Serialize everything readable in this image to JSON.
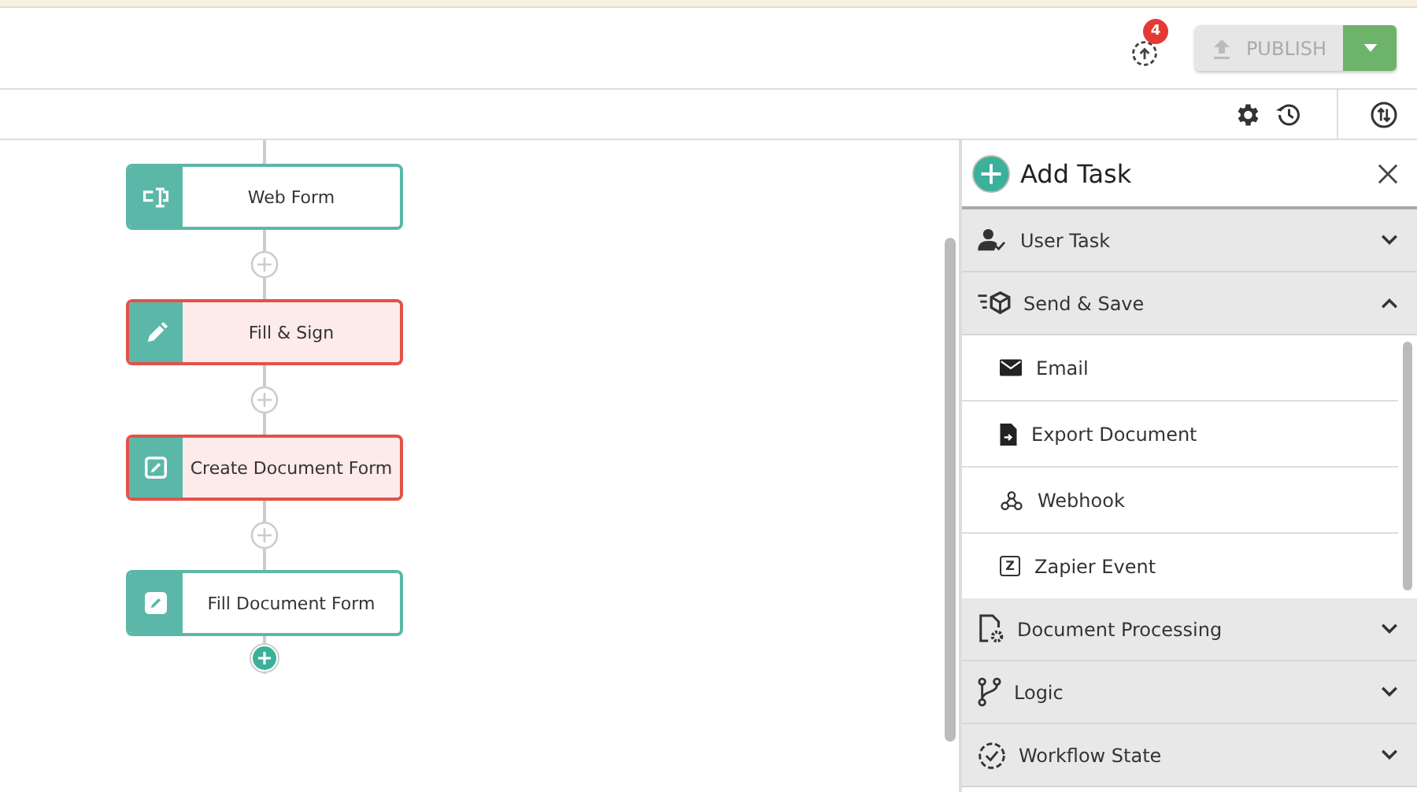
{
  "header": {
    "notification_count": "4",
    "publish": {
      "label": "PUBLISH",
      "disabled": true
    }
  },
  "nodes": [
    {
      "label": "Web Form",
      "kind": "web-form",
      "error": false
    },
    {
      "label": "Fill & Sign",
      "kind": "pen",
      "error": true
    },
    {
      "label": "Create Document Form",
      "kind": "edit-box",
      "error": true
    },
    {
      "label": "Fill Document Form",
      "kind": "edit-box",
      "error": false
    }
  ],
  "panel": {
    "title": "Add Task",
    "categories": [
      {
        "label": "User Task",
        "kind": "user",
        "expanded": false
      },
      {
        "label": "Send & Save",
        "kind": "send",
        "expanded": true,
        "items": [
          {
            "label": "Email",
            "kind": "mail"
          },
          {
            "label": "Export Document",
            "kind": "export"
          },
          {
            "label": "Webhook",
            "kind": "webhook"
          },
          {
            "label": "Zapier Event",
            "kind": "letter",
            "icon_letter": "Z"
          }
        ]
      },
      {
        "label": "Document Processing",
        "kind": "document",
        "expanded": false
      },
      {
        "label": "Logic",
        "kind": "logic",
        "expanded": false
      },
      {
        "label": "Workflow State",
        "kind": "state",
        "expanded": false
      }
    ]
  }
}
